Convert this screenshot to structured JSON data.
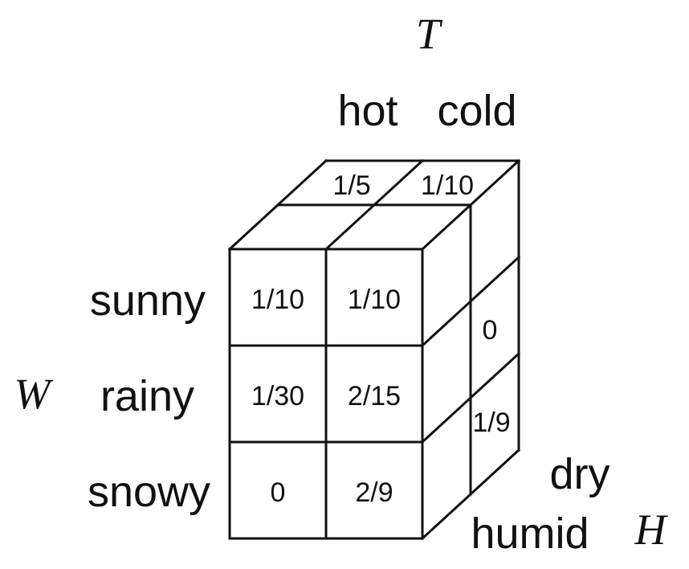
{
  "variables": {
    "temperature": "T",
    "weather": "W",
    "humidity": "H"
  },
  "temperature_values": [
    "hot",
    "cold"
  ],
  "weather_values": [
    "sunny",
    "rainy",
    "snowy"
  ],
  "humidity_values": [
    "dry",
    "humid"
  ],
  "front_face": {
    "sunny": [
      "1/10",
      "1/10"
    ],
    "rainy": [
      "1/30",
      "2/15"
    ],
    "snowy": [
      "0",
      "2/9"
    ]
  },
  "top_face": [
    "1/5",
    "1/10"
  ],
  "side_face": [
    "0",
    "1/9"
  ]
}
